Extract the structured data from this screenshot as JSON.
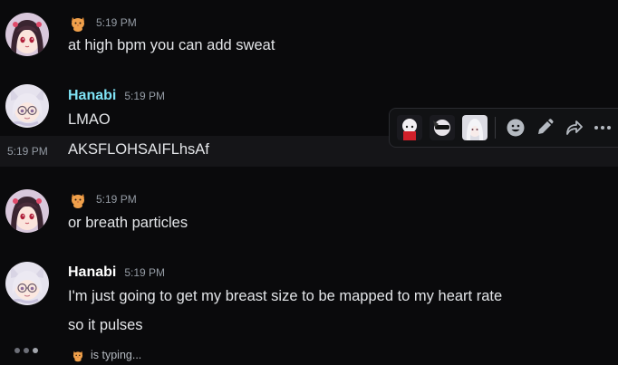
{
  "messages": [
    {
      "author": "",
      "time": "5:19 PM",
      "text": "at high bpm you can add sweat",
      "avatar_icon": "dark-haired-anime-girl-avatar"
    },
    {
      "author": "Hanabi",
      "author_color": "#7fe3f5",
      "time": "5:19 PM",
      "text": "LMAO",
      "avatar_icon": "white-haired-cat-girl-avatar"
    },
    {
      "time": "5:19 PM",
      "text": "AKSFLOHSAIFLhsAf"
    },
    {
      "author": "",
      "time": "5:19 PM",
      "text": "or breath particles",
      "avatar_icon": "dark-haired-anime-girl-avatar"
    },
    {
      "author": "Hanabi",
      "author_color": "#ffffff",
      "time": "5:19 PM",
      "text": "I'm just going to get my breast size to be mapped to my heart rate",
      "text2": "so it pulses",
      "avatar_icon": "white-haired-cat-girl-avatar"
    }
  ],
  "toolbar": {
    "reactions": [
      "sticker-girl-red",
      "sticker-girl-sunglasses",
      "sticker-girl-white-hair"
    ],
    "actions": [
      "emoji-icon",
      "pencil-icon",
      "forward-icon",
      "more-icon"
    ]
  },
  "typing": {
    "text": "is typing..."
  },
  "colors": {
    "background": "#0a0a0c",
    "hover_row": "#151518",
    "timestamp": "#949ba4"
  }
}
